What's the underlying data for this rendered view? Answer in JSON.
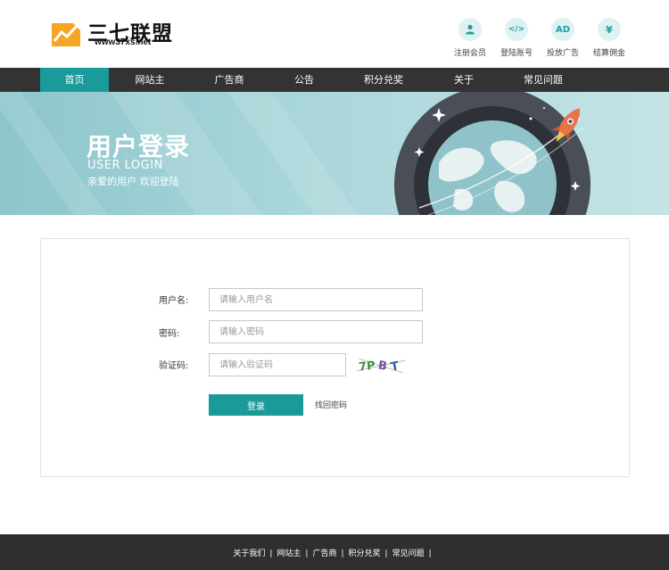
{
  "brand": {
    "name": "三七联盟",
    "url": "www37xs.net",
    "mark_color": "#f5a623"
  },
  "header_links": [
    {
      "icon": "user-icon",
      "glyph": "👤",
      "label": "注册会员"
    },
    {
      "icon": "code-icon",
      "glyph": "</>",
      "label": "登陆账号"
    },
    {
      "icon": "ad-icon",
      "glyph": "AD",
      "label": "投放广告"
    },
    {
      "icon": "yen-icon",
      "glyph": "¥",
      "label": "结算佣金"
    }
  ],
  "nav": {
    "items": [
      {
        "label": "首页",
        "active": true
      },
      {
        "label": "网站主",
        "active": false
      },
      {
        "label": "广告商",
        "active": false
      },
      {
        "label": "公告",
        "active": false
      },
      {
        "label": "积分兑奖",
        "active": false
      },
      {
        "label": "关于",
        "active": false
      },
      {
        "label": "常见问题",
        "active": false
      }
    ]
  },
  "banner": {
    "title": "用户登录",
    "subtitle": "USER LOGIN",
    "tagline": "亲爱的用户  欢迎登陆"
  },
  "login": {
    "username_label": "用户名:",
    "username_placeholder": "请输入用户名",
    "password_label": "密码:",
    "password_placeholder": "请输入密码",
    "captcha_label": "验证码:",
    "captcha_placeholder": "请输入验证码",
    "captcha_text": "7P B T",
    "submit_label": "登录",
    "forgot_label": "找回密码"
  },
  "footer": {
    "links": [
      "关于我们",
      "网站主",
      "广告商",
      "积分兑奖",
      "常见问题"
    ],
    "separator": "|"
  },
  "colors": {
    "accent": "#1b9a9b",
    "nav_bg": "#333333",
    "footer_bg": "#2f2f2f"
  }
}
